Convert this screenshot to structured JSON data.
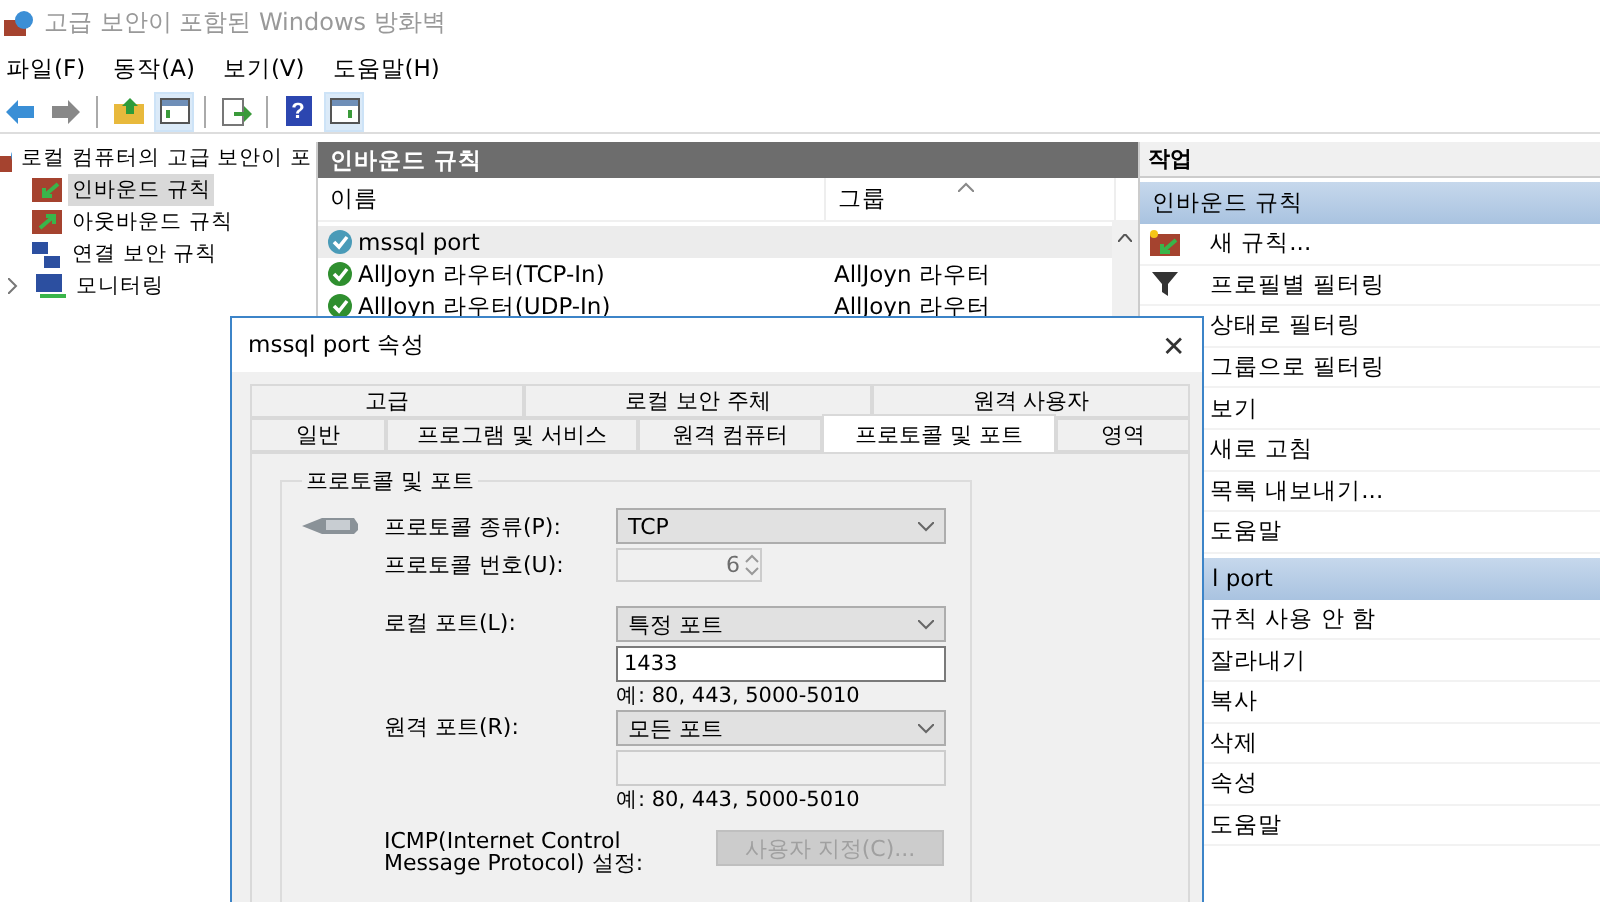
{
  "window": {
    "title": "고급 보안이 포함된 Windows 방화벽"
  },
  "menu": [
    "파일(F)",
    "동작(A)",
    "보기(V)",
    "도움말(H)"
  ],
  "toolbar": [
    {
      "kind": "back",
      "pressed": false
    },
    {
      "kind": "forward",
      "pressed": false
    },
    {
      "kind": "sep"
    },
    {
      "kind": "up",
      "pressed": false
    },
    {
      "kind": "tree",
      "pressed": true
    },
    {
      "kind": "sep"
    },
    {
      "kind": "export",
      "pressed": false
    },
    {
      "kind": "sep"
    },
    {
      "kind": "help",
      "pressed": false,
      "glyph": "?"
    },
    {
      "kind": "pane",
      "pressed": true
    }
  ],
  "tree": {
    "label": "로컬 컴퓨터의 고급 보안이 포",
    "children": [
      {
        "label": "인바운드 규칙",
        "kind": "inbound",
        "selected": true,
        "expandable": false
      },
      {
        "label": "아웃바운드 규칙",
        "kind": "outbound",
        "selected": false,
        "expandable": false
      },
      {
        "label": "연결 보안 규칙",
        "kind": "connection",
        "selected": false,
        "expandable": false
      },
      {
        "label": "모니터링",
        "kind": "monitor",
        "selected": false,
        "expandable": true
      }
    ]
  },
  "rules": {
    "title": "인바운드 규칙",
    "columns": [
      "이름",
      "그룹"
    ],
    "rows": [
      {
        "name": "mssql port",
        "group": "",
        "selected": true
      },
      {
        "name": "AllJoyn 라우터(TCP-In)",
        "group": "AllJoyn 라우터",
        "selected": false
      },
      {
        "name": "AllJoyn 라우터(UDP-In)",
        "group": "AllJoyn 라우터",
        "selected": false
      }
    ]
  },
  "actions": {
    "title": "작업",
    "sections": [
      {
        "title": "인바운드 규칙",
        "items": [
          {
            "label": "새 규칙...",
            "kind": "new-rule"
          },
          {
            "label": "프로필별 필터링",
            "kind": "filter"
          },
          {
            "label": "상태로 필터링",
            "kind": "none"
          },
          {
            "label": "그룹으로 필터링",
            "kind": "none"
          },
          {
            "label": "보기",
            "kind": "none"
          },
          {
            "label": "새로 고침",
            "kind": "none"
          },
          {
            "label": "목록 내보내기...",
            "kind": "none"
          },
          {
            "label": "도움말",
            "kind": "none"
          }
        ]
      },
      {
        "title": "l port",
        "items": [
          {
            "label": "규칙 사용 안 함",
            "kind": "none"
          },
          {
            "label": "잘라내기",
            "kind": "none"
          },
          {
            "label": "복사",
            "kind": "none"
          },
          {
            "label": "삭제",
            "kind": "none"
          },
          {
            "label": "속성",
            "kind": "none"
          },
          {
            "label": "도움말",
            "kind": "none"
          }
        ]
      }
    ]
  },
  "dialog": {
    "title": "mssql port 속성",
    "close": "✕",
    "tab_rows": [
      [
        {
          "label": "고급",
          "selected": false
        },
        {
          "label": "로컬 보안 주체",
          "selected": false
        },
        {
          "label": "원격 사용자",
          "selected": false
        }
      ],
      [
        {
          "label": "일반",
          "selected": false
        },
        {
          "label": "프로그램 및 서비스",
          "selected": false
        },
        {
          "label": "원격 컴퓨터",
          "selected": false
        },
        {
          "label": "프로토콜 및 포트",
          "selected": true
        },
        {
          "label": "영역",
          "selected": false
        }
      ]
    ],
    "group": "프로토콜 및 포트",
    "protocol_type": {
      "label": "프로토콜 종류(P):",
      "value": "TCP"
    },
    "protocol_number": {
      "label": "프로토콜 번호(U):",
      "value": "6",
      "disabled": true
    },
    "local_port": {
      "label": "로컬 포트(L):",
      "value": "특정 포트",
      "input": "1433",
      "hint": "예: 80, 443, 5000-5010"
    },
    "remote_port": {
      "label": "원격 포트(R):",
      "value": "모든 포트",
      "input_disabled": true,
      "hint": "예: 80, 443, 5000-5010"
    },
    "icmp": {
      "label": "ICMP(Internet Control Message Protocol) 설정:",
      "button": "사용자 지정(C)...",
      "disabled": true
    }
  }
}
